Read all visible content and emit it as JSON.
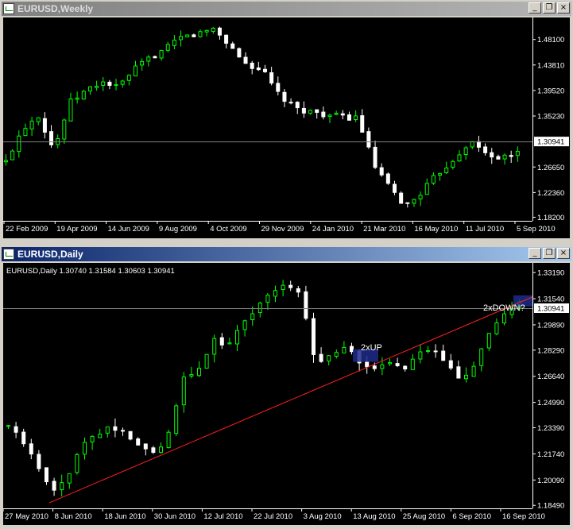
{
  "windows": [
    {
      "title": "EURUSD,Weekly",
      "state": "inactive",
      "price_levels": [
        "1.48100",
        "1.43810",
        "1.39520",
        "1.35230",
        "1.26650",
        "1.22360",
        "1.18200"
      ],
      "current_price": "1.30941",
      "date_labels": [
        "22 Feb 2009",
        "19 Apr 2009",
        "14 Jun 2009",
        "9 Aug 2009",
        "4 Oct 2009",
        "29 Nov 2009",
        "24 Jan 2010",
        "21 Mar 2010",
        "16 May 2010",
        "11 Jul 2010",
        "5 Sep 2010"
      ]
    },
    {
      "title": "EURUSD,Daily",
      "state": "active",
      "info": "EURUSD,Daily  1.30740 1.31584 1.30603 1.30941",
      "price_levels": [
        "1.33190",
        "1.31540",
        "1.29890",
        "1.28290",
        "1.26640",
        "1.24990",
        "1.23390",
        "1.21740",
        "1.20090",
        "1.18490"
      ],
      "current_price": "1.30941",
      "date_labels": [
        "27 May 2010",
        "8 Jun 2010",
        "18 Jun 2010",
        "30 Jun 2010",
        "12 Jul 2010",
        "22 Jul 2010",
        "3 Aug 2010",
        "13 Aug 2010",
        "25 Aug 2010",
        "6 Sep 2010",
        "16 Sep 2010"
      ],
      "annotations": {
        "up": "2xUP",
        "down": "2xDOWN?"
      }
    }
  ],
  "controls": {
    "minimize": "_",
    "restore": "❐",
    "close": "×"
  },
  "colors": {
    "candle_up": "#00ff00",
    "candle_down": "#ffffff",
    "trendline": "#ff2020",
    "highlight": "#1e2a8a",
    "price_line": "#808080"
  },
  "chart_data": [
    {
      "type": "candlestick",
      "title": "EURUSD,Weekly",
      "x": [
        "22 Feb 2009",
        "19 Apr 2009",
        "14 Jun 2009",
        "9 Aug 2009",
        "4 Oct 2009",
        "29 Nov 2009",
        "24 Jan 2010",
        "21 Mar 2010",
        "16 May 2010",
        "11 Jul 2010",
        "5 Sep 2010"
      ],
      "close_path": [
        1.275,
        1.33,
        1.355,
        1.295,
        1.375,
        1.395,
        1.41,
        1.4,
        1.43,
        1.45,
        1.465,
        1.485,
        1.49,
        1.5,
        1.47,
        1.44,
        1.43,
        1.39,
        1.365,
        1.36,
        1.355,
        1.35,
        1.35,
        1.27,
        1.23,
        1.2,
        1.225,
        1.255,
        1.28,
        1.31,
        1.29,
        1.28,
        1.29
      ],
      "ylim": [
        1.176,
        1.518
      ],
      "current": 1.30941
    },
    {
      "type": "candlestick",
      "title": "EURUSD,Daily",
      "x": [
        "27 May 2010",
        "8 Jun 2010",
        "18 Jun 2010",
        "30 Jun 2010",
        "12 Jul 2010",
        "22 Jul 2010",
        "3 Aug 2010",
        "13 Aug 2010",
        "25 Aug 2010",
        "6 Sep 2010",
        "16 Sep 2010"
      ],
      "close_path": [
        1.235,
        1.225,
        1.21,
        1.195,
        1.2,
        1.225,
        1.23,
        1.235,
        1.23,
        1.222,
        1.217,
        1.23,
        1.265,
        1.27,
        1.29,
        1.285,
        1.3,
        1.31,
        1.32,
        1.325,
        1.318,
        1.275,
        1.28,
        1.286,
        1.276,
        1.27,
        1.275,
        1.27,
        1.28,
        1.283,
        1.275,
        1.265,
        1.275,
        1.295,
        1.305,
        1.313
      ],
      "trendline": [
        [
          0,
          1.1865
        ],
        [
          67,
          1.3165
        ]
      ],
      "ylim": [
        1.183,
        1.338
      ],
      "current": 1.30941
    }
  ]
}
